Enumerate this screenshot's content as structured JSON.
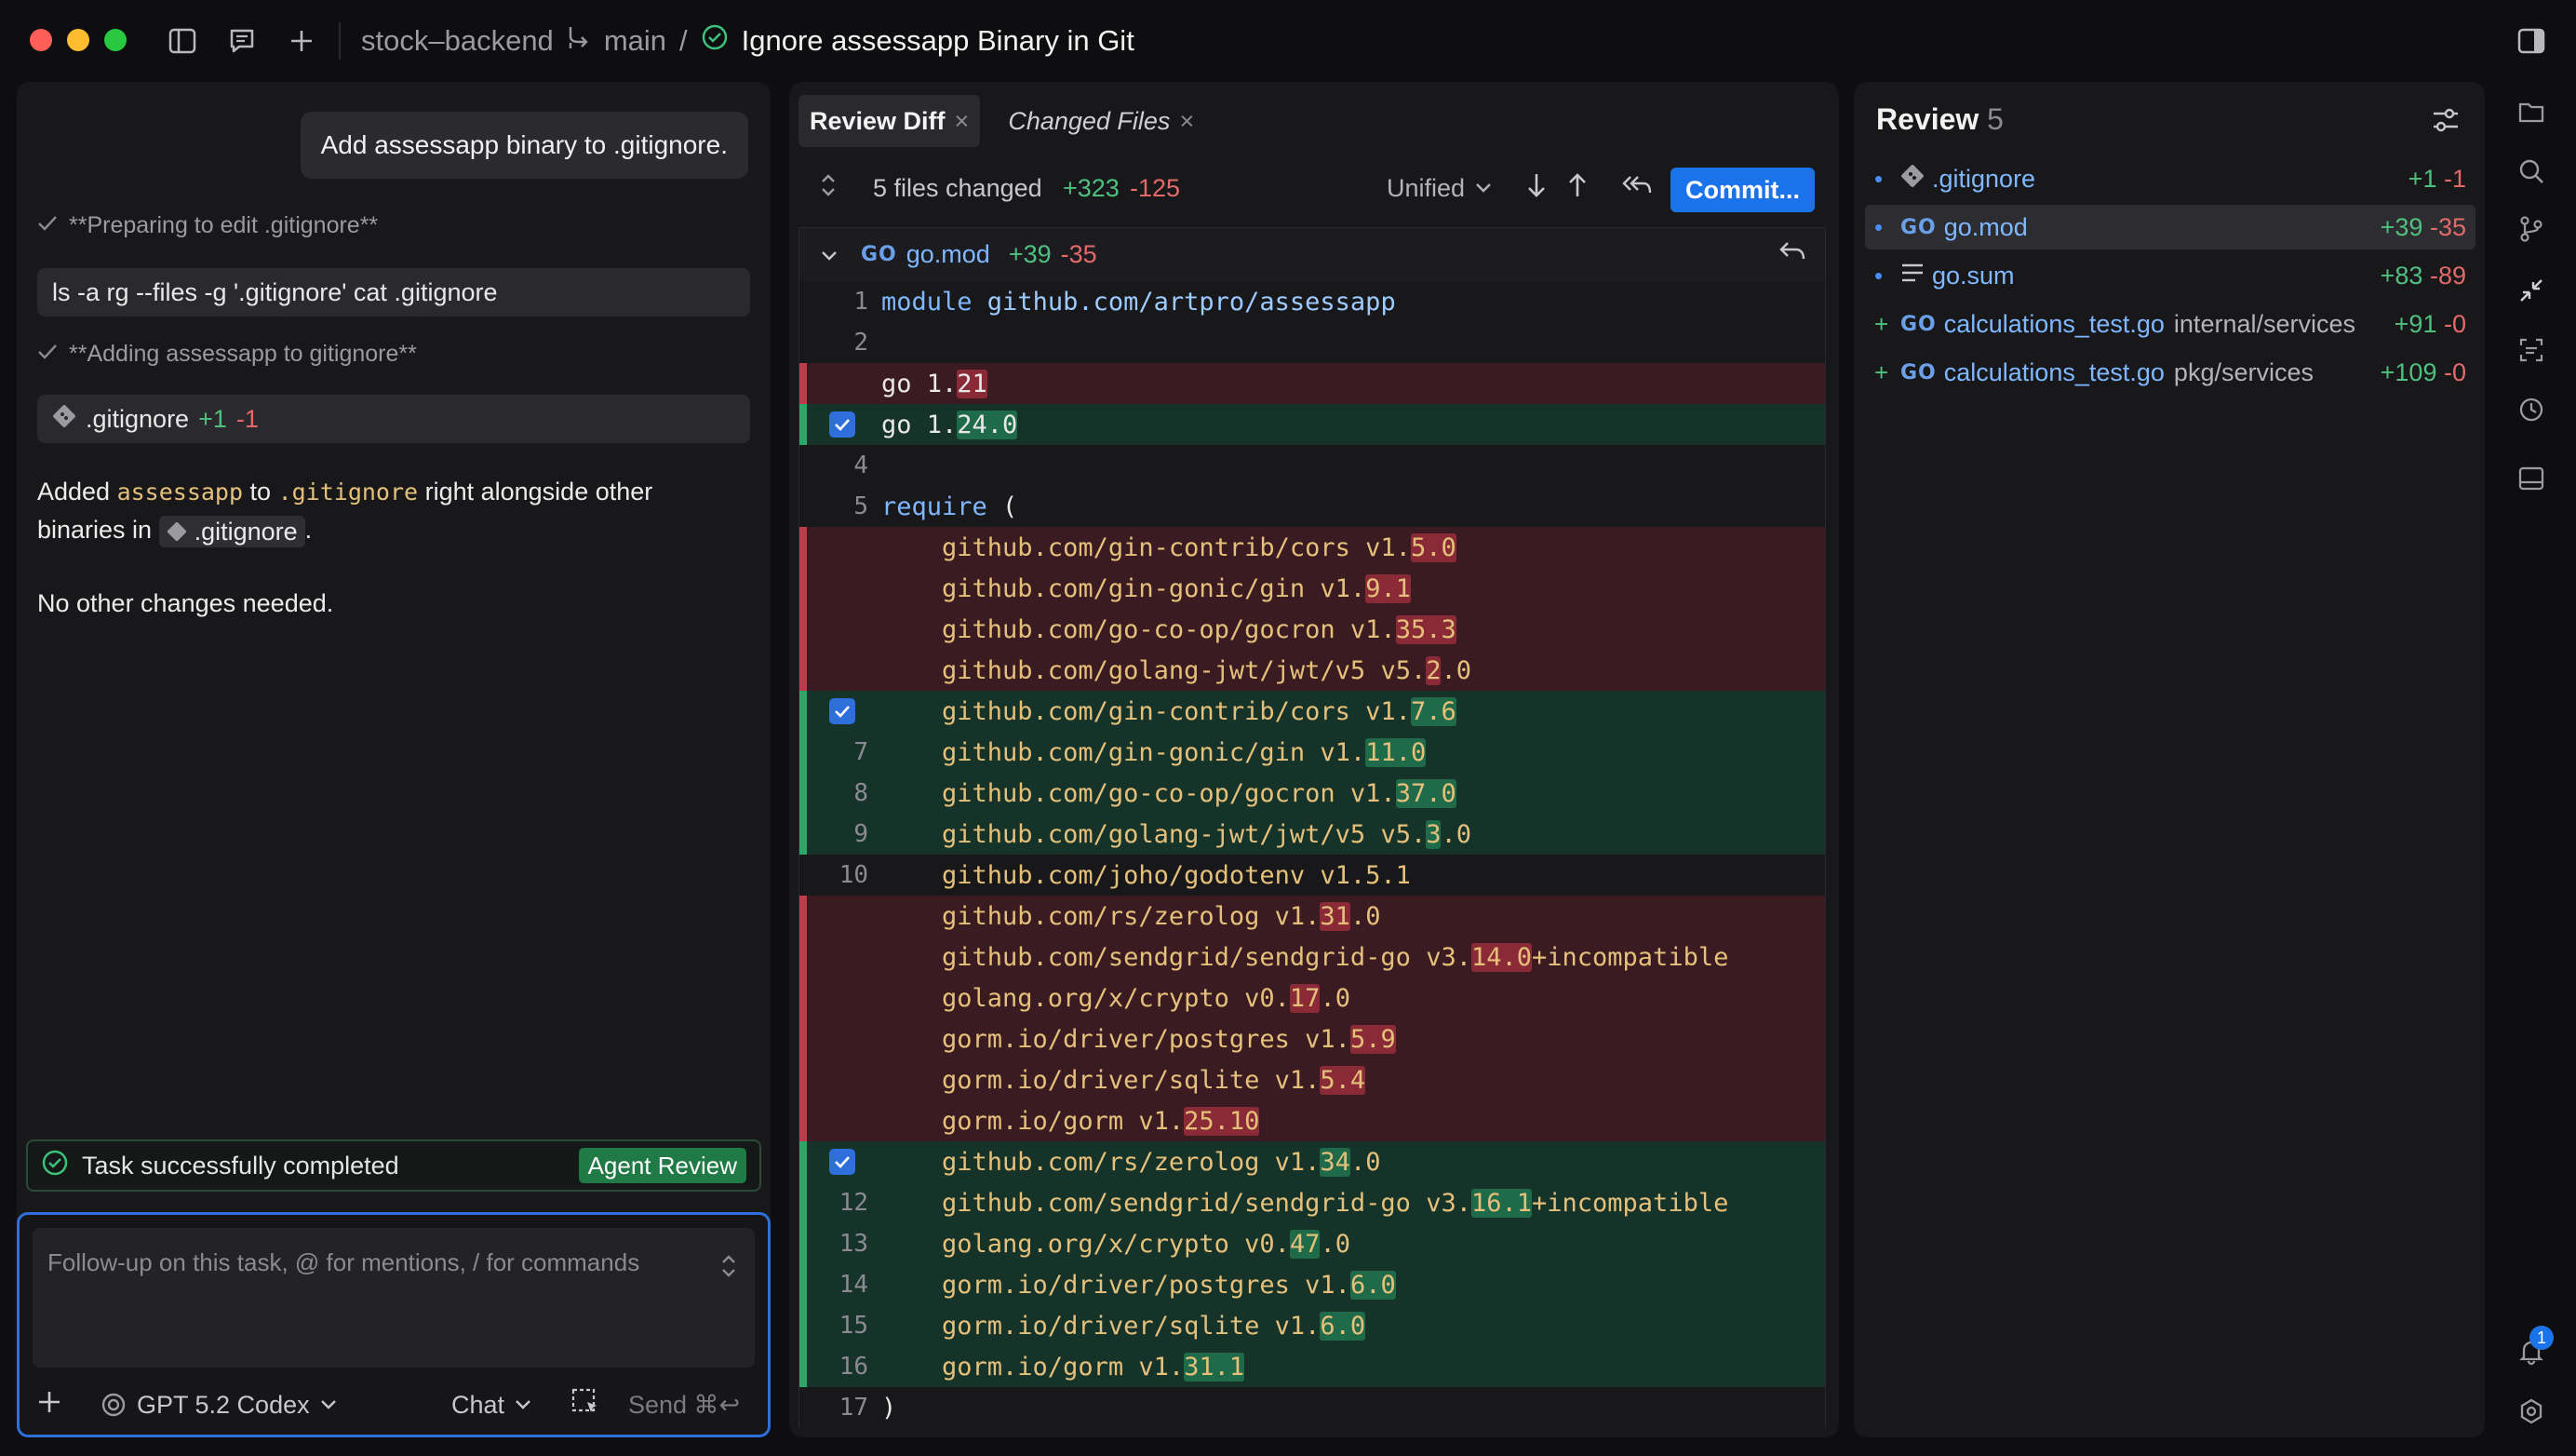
{
  "window": {
    "project": "stock–backend",
    "branch": "main",
    "separator": "/",
    "task_title": "Ignore assessapp Binary in Git"
  },
  "chat": {
    "user_message": "Add assessapp binary to .gitignore.",
    "steps": [
      {
        "text": "**Preparing to edit .gitignore**"
      },
      {
        "text": "**Adding assessapp to gitignore**"
      }
    ],
    "command": "ls -a rg --files -g '.gitignore' cat .gitignore",
    "file_chip": {
      "name": ".gitignore",
      "add": "+1",
      "del": "-1"
    },
    "reply_p1_a": "Added ",
    "reply_p1_code1": "assessapp",
    "reply_p1_b": " to ",
    "reply_p1_code2": ".gitignore",
    "reply_p1_c": " right alongside other binaries in ",
    "reply_p1_chip": ".gitignore",
    "reply_p1_d": ".",
    "reply_p2": "No other changes needed.",
    "status": "Task successfully completed",
    "agent_review": "Agent Review",
    "composer_placeholder": "Follow-up on this task, @ for mentions, / for commands",
    "model": "GPT 5.2 Codex",
    "mode": "Chat",
    "send": "Send ⌘↩"
  },
  "diff": {
    "tabs": [
      {
        "label": "Review Diff",
        "close": "×"
      },
      {
        "label": "Changed Files",
        "close": "×"
      }
    ],
    "summary": "5 files changed",
    "summary_add": "+323",
    "summary_del": "-125",
    "view_mode": "Unified",
    "commit": "Commit...",
    "file": {
      "badge": "GO",
      "name": "go.mod",
      "add": "+39",
      "del": "-35"
    },
    "lines": [
      {
        "type": "ctx",
        "num": "1",
        "check": false,
        "parts": [
          {
            "t": "module",
            "c": "kw"
          },
          {
            "t": " github.com/artpro/assessapp",
            "c": "mod"
          }
        ]
      },
      {
        "type": "ctx",
        "num": "2",
        "check": false,
        "parts": []
      },
      {
        "type": "del",
        "num": "",
        "check": false,
        "parts": [
          {
            "t": "go 1."
          },
          {
            "t": "21",
            "h": 1
          }
        ]
      },
      {
        "type": "add",
        "num": "",
        "check": true,
        "parts": [
          {
            "t": "go 1."
          },
          {
            "t": "24.0",
            "h": 1
          }
        ]
      },
      {
        "type": "ctx",
        "num": "4",
        "check": false,
        "parts": []
      },
      {
        "type": "ctx",
        "num": "5",
        "check": false,
        "parts": [
          {
            "t": "require",
            "c": "kw"
          },
          {
            "t": " ("
          }
        ]
      },
      {
        "type": "del",
        "num": "",
        "check": false,
        "parts": [
          {
            "t": "    github.com/gin-contrib/cors ",
            "c": "y"
          },
          {
            "t": "v1.",
            "c": "y"
          },
          {
            "t": "5.0",
            "c": "y",
            "h": 1
          }
        ]
      },
      {
        "type": "del",
        "num": "",
        "check": false,
        "parts": [
          {
            "t": "    github.com/gin-gonic/gin ",
            "c": "y"
          },
          {
            "t": "v1.",
            "c": "y"
          },
          {
            "t": "9.1",
            "c": "y",
            "h": 1
          }
        ]
      },
      {
        "type": "del",
        "num": "",
        "check": false,
        "parts": [
          {
            "t": "    github.com/go-co-op/gocron ",
            "c": "y"
          },
          {
            "t": "v1.",
            "c": "y"
          },
          {
            "t": "35.3",
            "c": "y",
            "h": 1
          }
        ]
      },
      {
        "type": "del",
        "num": "",
        "check": false,
        "parts": [
          {
            "t": "    github.com/golang-jwt/jwt/v5 ",
            "c": "y"
          },
          {
            "t": "v5.",
            "c": "y"
          },
          {
            "t": "2",
            "c": "y",
            "h": 1
          },
          {
            "t": ".0",
            "c": "y"
          }
        ]
      },
      {
        "type": "add",
        "num": "",
        "check": true,
        "parts": [
          {
            "t": "    github.com/gin-contrib/cors ",
            "c": "y"
          },
          {
            "t": "v1.",
            "c": "y"
          },
          {
            "t": "7.6",
            "c": "y",
            "h": 1
          }
        ]
      },
      {
        "type": "add",
        "num": "7",
        "check": false,
        "parts": [
          {
            "t": "    github.com/gin-gonic/gin ",
            "c": "y"
          },
          {
            "t": "v1.",
            "c": "y"
          },
          {
            "t": "11.0",
            "c": "y",
            "h": 1
          }
        ]
      },
      {
        "type": "add",
        "num": "8",
        "check": false,
        "parts": [
          {
            "t": "    github.com/go-co-op/gocron ",
            "c": "y"
          },
          {
            "t": "v1.",
            "c": "y"
          },
          {
            "t": "37.0",
            "c": "y",
            "h": 1
          }
        ]
      },
      {
        "type": "add",
        "num": "9",
        "check": false,
        "parts": [
          {
            "t": "    github.com/golang-jwt/jwt/v5 ",
            "c": "y"
          },
          {
            "t": "v5.",
            "c": "y"
          },
          {
            "t": "3",
            "c": "y",
            "h": 1
          },
          {
            "t": ".0",
            "c": "y"
          }
        ]
      },
      {
        "type": "ctx",
        "num": "10",
        "check": false,
        "parts": [
          {
            "t": "    github.com/joho/godotenv v1.5.1",
            "c": "y"
          }
        ]
      },
      {
        "type": "del",
        "num": "",
        "check": false,
        "parts": [
          {
            "t": "    github.com/rs/zerolog ",
            "c": "y"
          },
          {
            "t": "v1.",
            "c": "y"
          },
          {
            "t": "31",
            "c": "y",
            "h": 1
          },
          {
            "t": ".0",
            "c": "y"
          }
        ]
      },
      {
        "type": "del",
        "num": "",
        "check": false,
        "parts": [
          {
            "t": "    github.com/sendgrid/sendgrid-go ",
            "c": "y"
          },
          {
            "t": "v3.",
            "c": "y"
          },
          {
            "t": "14.0",
            "c": "y",
            "h": 1
          },
          {
            "t": "+incompatible",
            "c": "y"
          }
        ]
      },
      {
        "type": "del",
        "num": "",
        "check": false,
        "parts": [
          {
            "t": "    golang.org/x/crypto ",
            "c": "y"
          },
          {
            "t": "v0.",
            "c": "y"
          },
          {
            "t": "17",
            "c": "y",
            "h": 1
          },
          {
            "t": ".0",
            "c": "y"
          }
        ]
      },
      {
        "type": "del",
        "num": "",
        "check": false,
        "parts": [
          {
            "t": "    gorm.io/driver/postgres ",
            "c": "y"
          },
          {
            "t": "v1.",
            "c": "y"
          },
          {
            "t": "5.9",
            "c": "y",
            "h": 1
          }
        ]
      },
      {
        "type": "del",
        "num": "",
        "check": false,
        "parts": [
          {
            "t": "    gorm.io/driver/sqlite ",
            "c": "y"
          },
          {
            "t": "v1.",
            "c": "y"
          },
          {
            "t": "5.4",
            "c": "y",
            "h": 1
          }
        ]
      },
      {
        "type": "del",
        "num": "",
        "check": false,
        "parts": [
          {
            "t": "    gorm.io/gorm ",
            "c": "y"
          },
          {
            "t": "v1.",
            "c": "y"
          },
          {
            "t": "25.10",
            "c": "y",
            "h": 1
          }
        ]
      },
      {
        "type": "add",
        "num": "",
        "check": true,
        "parts": [
          {
            "t": "    github.com/rs/zerolog ",
            "c": "y"
          },
          {
            "t": "v1.",
            "c": "y"
          },
          {
            "t": "34",
            "c": "y",
            "h": 1
          },
          {
            "t": ".0",
            "c": "y"
          }
        ]
      },
      {
        "type": "add",
        "num": "12",
        "check": false,
        "parts": [
          {
            "t": "    github.com/sendgrid/sendgrid-go ",
            "c": "y"
          },
          {
            "t": "v3.",
            "c": "y"
          },
          {
            "t": "16.1",
            "c": "y",
            "h": 1
          },
          {
            "t": "+incompatible",
            "c": "y"
          }
        ]
      },
      {
        "type": "add",
        "num": "13",
        "check": false,
        "parts": [
          {
            "t": "    golang.org/x/crypto ",
            "c": "y"
          },
          {
            "t": "v0.",
            "c": "y"
          },
          {
            "t": "47",
            "c": "y",
            "h": 1
          },
          {
            "t": ".0",
            "c": "y"
          }
        ]
      },
      {
        "type": "add",
        "num": "14",
        "check": false,
        "parts": [
          {
            "t": "    gorm.io/driver/postgres ",
            "c": "y"
          },
          {
            "t": "v1.",
            "c": "y"
          },
          {
            "t": "6.0",
            "c": "y",
            "h": 1
          }
        ]
      },
      {
        "type": "add",
        "num": "15",
        "check": false,
        "parts": [
          {
            "t": "    gorm.io/driver/sqlite ",
            "c": "y"
          },
          {
            "t": "v1.",
            "c": "y"
          },
          {
            "t": "6.0",
            "c": "y",
            "h": 1
          }
        ]
      },
      {
        "type": "add",
        "num": "16",
        "check": false,
        "parts": [
          {
            "t": "    gorm.io/gorm ",
            "c": "y"
          },
          {
            "t": "v1.",
            "c": "y"
          },
          {
            "t": "31.1",
            "c": "y",
            "h": 1
          }
        ]
      },
      {
        "type": "ctx",
        "num": "17",
        "check": false,
        "parts": [
          {
            "t": ")"
          }
        ]
      }
    ]
  },
  "review": {
    "title": "Review",
    "count": "5",
    "items": [
      {
        "mark": "•",
        "icon": "git",
        "name": ".gitignore",
        "path": "",
        "add": "+1",
        "del": "-1",
        "selected": false
      },
      {
        "mark": "•",
        "icon": "GO",
        "name": "go.mod",
        "path": "",
        "add": "+39",
        "del": "-35",
        "selected": true
      },
      {
        "mark": "•",
        "icon": "lines",
        "name": "go.sum",
        "path": "",
        "add": "+83",
        "del": "-89",
        "selected": false
      },
      {
        "mark": "+",
        "icon": "GO",
        "name": "calculations_test.go",
        "path": "internal/services",
        "add": "+91",
        "del": "-0",
        "selected": false
      },
      {
        "mark": "+",
        "icon": "GO",
        "name": "calculations_test.go",
        "path": "pkg/services",
        "add": "+109",
        "del": "-0",
        "selected": false
      }
    ]
  },
  "notifications": {
    "count": "1"
  },
  "colors": {
    "accent": "#1a73e8",
    "add": "#4fc07f",
    "del": "#e46a6a",
    "code_yellow": "#e5c07b",
    "keyword": "#7fb8ff"
  }
}
